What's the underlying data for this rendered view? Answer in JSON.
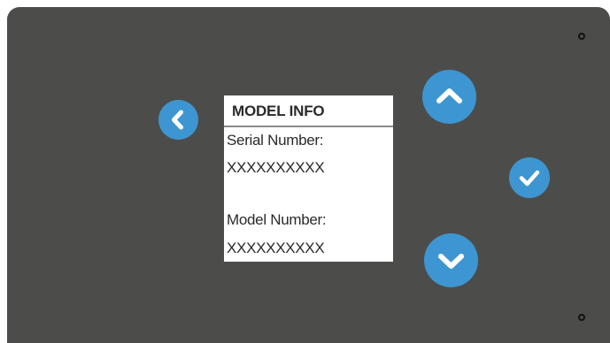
{
  "screen": {
    "title": "MODEL INFO",
    "serial_label": "Serial Number:",
    "serial_value": "XXXXXXXXXX",
    "model_label": "Model Number:",
    "model_value": "XXXXXXXXXX"
  },
  "buttons": {
    "back_icon": "chevron-left-icon",
    "up_icon": "chevron-up-icon",
    "confirm_icon": "checkmark-icon",
    "down_icon": "chevron-down-icon"
  },
  "colors": {
    "panel": "#4c4d4b",
    "button": "#3d96d1",
    "screen_bg": "#ffffff"
  }
}
